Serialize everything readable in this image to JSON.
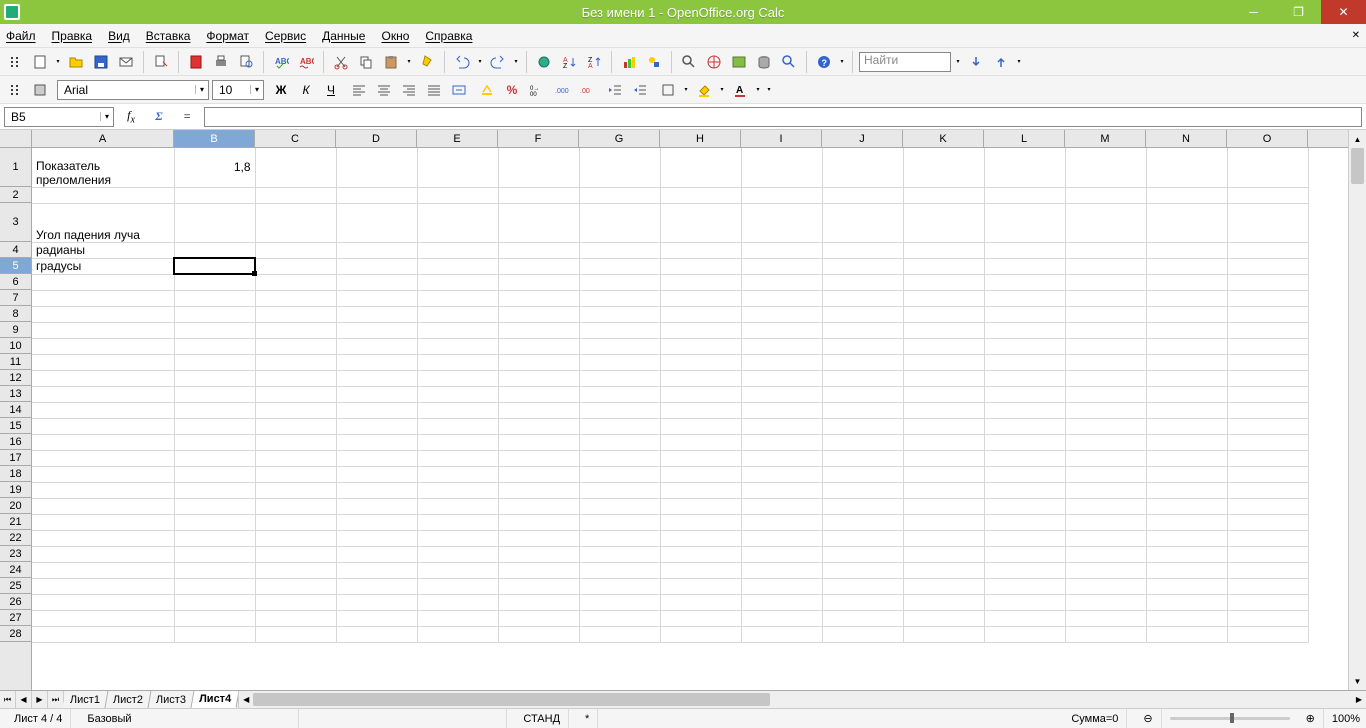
{
  "title": "Без имени 1 - OpenOffice.org Calc",
  "menus": [
    "Файл",
    "Правка",
    "Вид",
    "Вставка",
    "Формат",
    "Сервис",
    "Данные",
    "Окно",
    "Справка"
  ],
  "search_placeholder": "Найти",
  "formula": {
    "cell_ref": "B5",
    "equals": "="
  },
  "font": {
    "name": "Arial",
    "size": "10"
  },
  "columns": [
    "A",
    "B",
    "C",
    "D",
    "E",
    "F",
    "G",
    "H",
    "I",
    "J",
    "K",
    "L",
    "M",
    "N",
    "O"
  ],
  "selected_column": "B",
  "selected_row": 5,
  "col_widths": {
    "A": 142,
    "default": 81
  },
  "row_heights": {
    "1": 39,
    "2": 16,
    "3": 39,
    "default": 16,
    "count": 28
  },
  "cells": {
    "A1": "Показатель преломления",
    "B1": "1,8",
    "A3": "Угол падения луча",
    "A4": "радианы",
    "A5": "градусы"
  },
  "tabs": [
    "Лист1",
    "Лист2",
    "Лист3",
    "Лист4"
  ],
  "active_tab": "Лист4",
  "status": {
    "sheet": "Лист 4 / 4",
    "style": "Базовый",
    "mode": "СТАНД",
    "modified": "*",
    "sum": "Сумма=0",
    "zoom": "100%"
  }
}
